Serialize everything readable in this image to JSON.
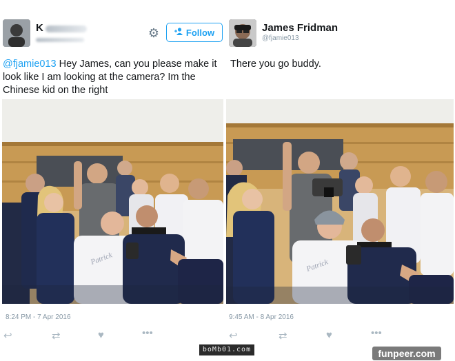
{
  "left_tweet": {
    "author_name_visible": "K",
    "text_mention": "@fjamie013",
    "text_body": " Hey James, can you please make it look like I am looking at the camera? Im the Chinese kid on the right",
    "follow_label": "Follow",
    "timestamp": "8:24 PM - 7 Apr 2016",
    "icons": [
      "gear-icon",
      "follow-user-icon",
      "reply-icon",
      "retweet-icon",
      "like-icon",
      "more-icon"
    ]
  },
  "right_tweet": {
    "author_name": "James Fridman",
    "author_handle": "@fjamie013",
    "text": "There you go buddy.",
    "timestamp": "9:45 AM - 8 Apr 2016",
    "icons": [
      "reply-icon",
      "retweet-icon",
      "like-icon",
      "more-icon"
    ]
  },
  "watermarks": {
    "bombo": "boMb01.com",
    "funpeer": "funpeer.com"
  },
  "colors": {
    "link_blue": "#1da1f2",
    "meta_gray": "#8899a6",
    "icon_gray": "#aab8c2",
    "wall_wood": "#c89a54"
  }
}
